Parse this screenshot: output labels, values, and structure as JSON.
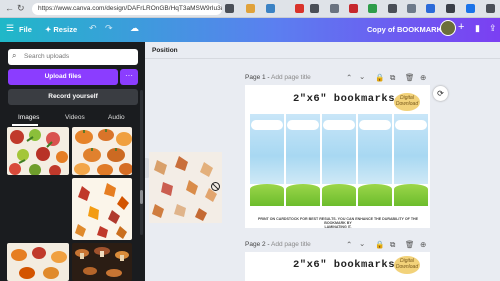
{
  "browser": {
    "url": "https://www.canva.com/design/DAFrLROnGB/HqT3aMSW9rIu3EE...",
    "back_icon": "arrow-left-icon",
    "forward_icon": "arrow-right-icon"
  },
  "topbar": {
    "file_label": "File",
    "resize_label": "Resize",
    "design_title": "Copy of BOOKMARKS",
    "accent": "#8b3dff"
  },
  "left_panel": {
    "search_placeholder": "Search uploads",
    "upload_button": "Upload files",
    "more_label": "···",
    "record_button": "Record yourself",
    "tabs": [
      {
        "label": "Images",
        "active": true
      },
      {
        "label": "Videos",
        "active": false
      },
      {
        "label": "Audio",
        "active": false
      }
    ]
  },
  "canvas": {
    "position_label": "Position",
    "pages": [
      {
        "number": "Page 1",
        "separator": " - ",
        "title_placeholder": "Add page title"
      },
      {
        "number": "Page 2",
        "separator": " - ",
        "title_placeholder": "Add page title"
      }
    ],
    "bookmark_title": "2\"x6\" bookmarks",
    "badge_text": "Digital Download",
    "fine_print_line1": "PRINT ON CARDSTOCK FOR BEST RESULTS. YOU CAN ENHANCE THE DURABILITY OF THE BOOKMARK BY",
    "fine_print_line2": "LAMINATING IT."
  }
}
